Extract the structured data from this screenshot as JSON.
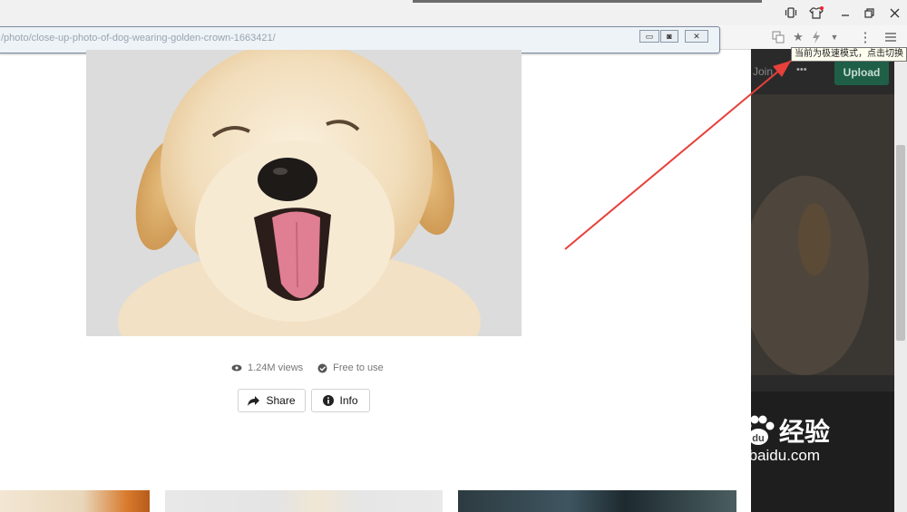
{
  "browser": {
    "url_text": "/photo/close-up-photo-of-dog-wearing-golden-crown-1663421/",
    "tooltip": "当前为极速模式，点击切换",
    "window_controls": [
      "minimize",
      "restore",
      "close"
    ]
  },
  "overlay": {
    "join_label": "Join",
    "more_label": "•••",
    "upload_label": "Upload"
  },
  "photo_meta": {
    "views": "1.24M views",
    "license": "Free to use"
  },
  "actions": {
    "share_label": "Share",
    "info_label": "Info"
  },
  "watermark": {
    "brand": "Bai",
    "brand2": "du",
    "cn": "经验",
    "domain": "jingyan.baidu.com"
  },
  "colors": {
    "accent_arrow": "#e8403a",
    "upload_green": "#1f5f48"
  }
}
